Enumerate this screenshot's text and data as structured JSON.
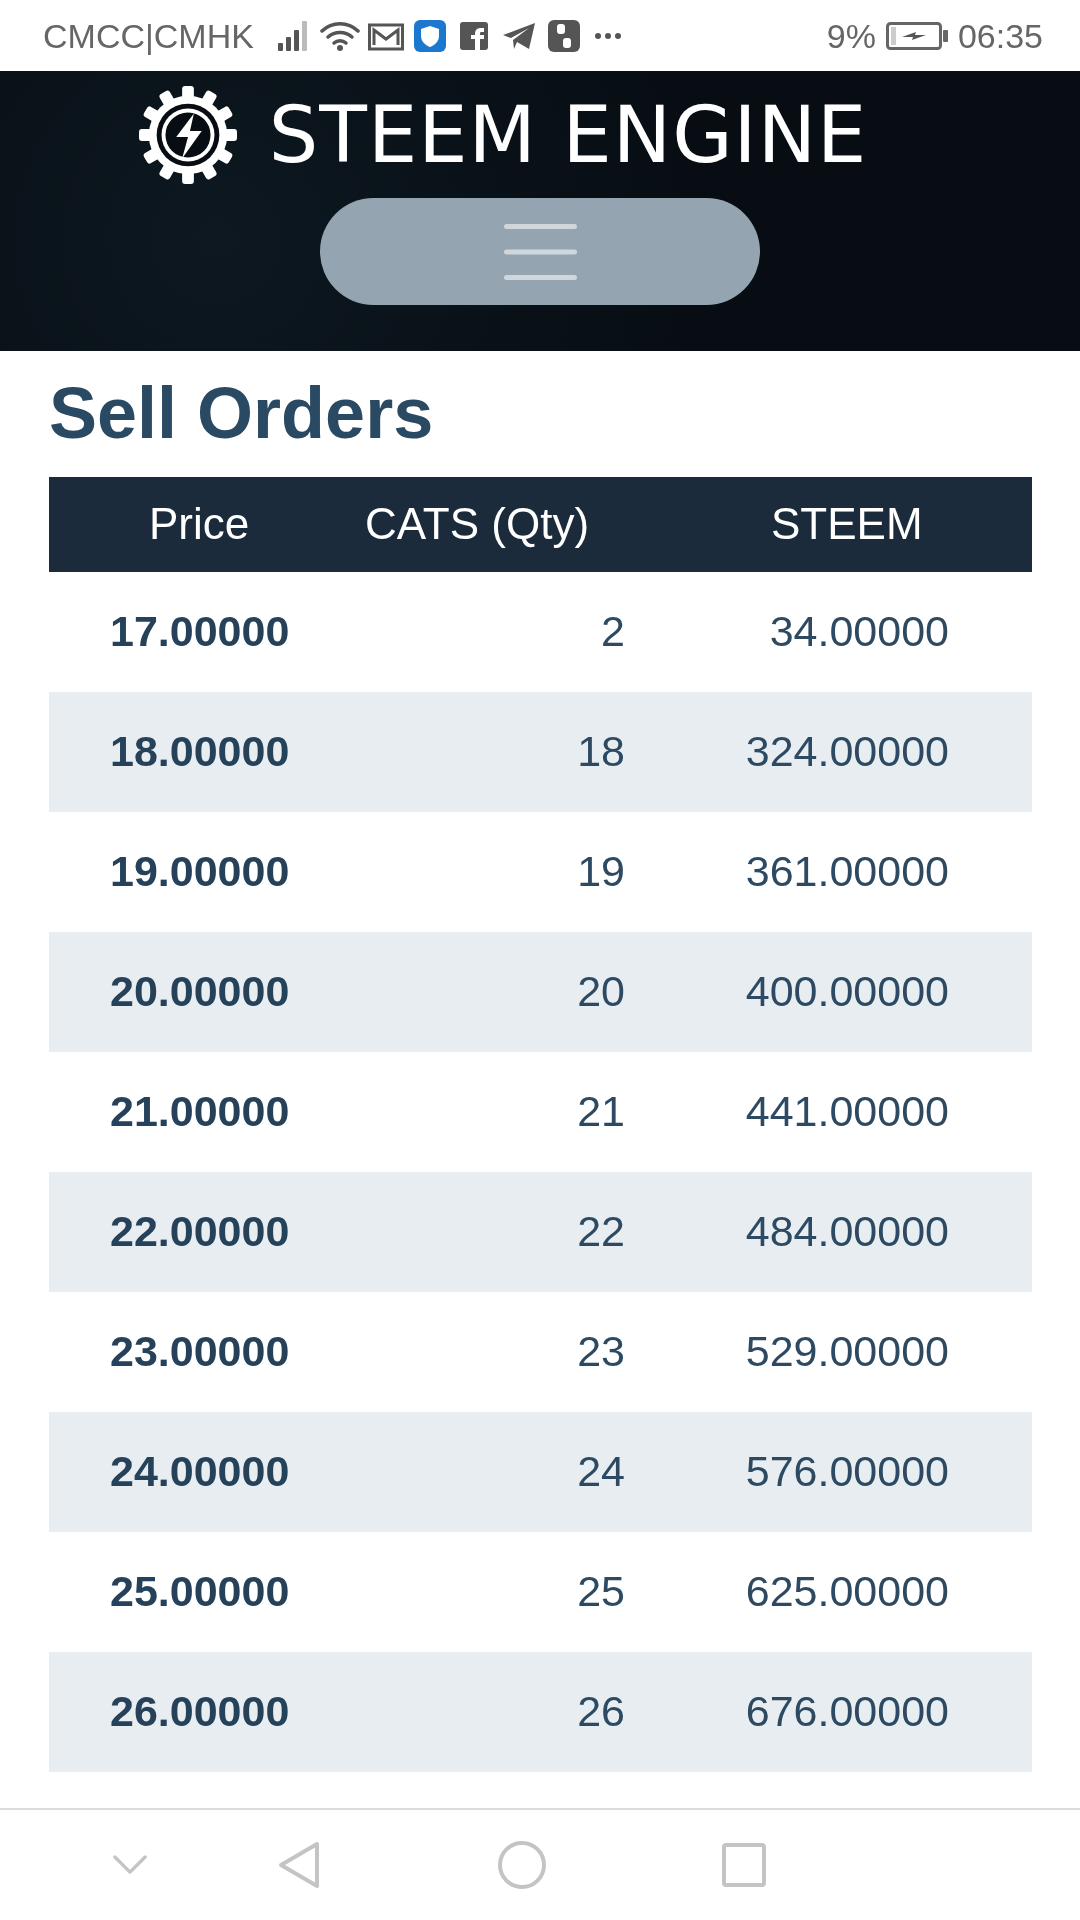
{
  "status_bar": {
    "carrier": "CMCC|CMHK",
    "battery": "9%",
    "time": "06:35"
  },
  "header": {
    "logo_text": "STEEM ENGINE"
  },
  "section": {
    "title": "Sell Orders"
  },
  "table": {
    "columns": [
      "Price",
      "CATS (Qty)",
      "STEEM"
    ],
    "rows": [
      [
        "17.00000",
        "2",
        "34.00000"
      ],
      [
        "18.00000",
        "18",
        "324.00000"
      ],
      [
        "19.00000",
        "19",
        "361.00000"
      ],
      [
        "20.00000",
        "20",
        "400.00000"
      ],
      [
        "21.00000",
        "21",
        "441.00000"
      ],
      [
        "22.00000",
        "22",
        "484.00000"
      ],
      [
        "23.00000",
        "23",
        "529.00000"
      ],
      [
        "24.00000",
        "24",
        "576.00000"
      ],
      [
        "25.00000",
        "25",
        "625.00000"
      ],
      [
        "26.00000",
        "26",
        "676.00000"
      ]
    ]
  }
}
